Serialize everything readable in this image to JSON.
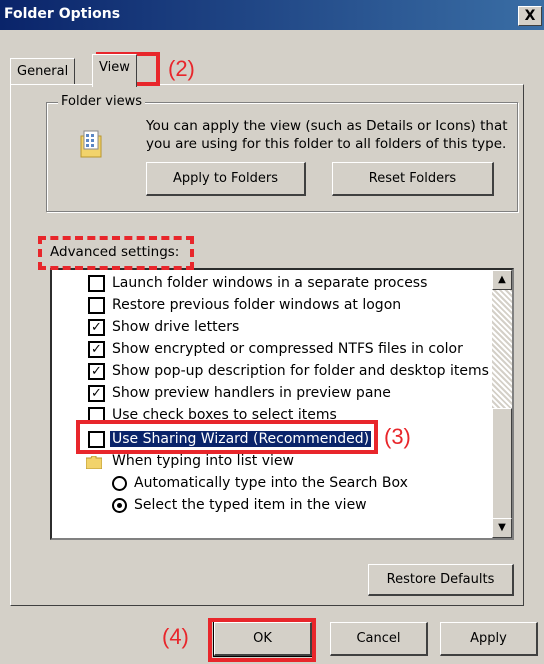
{
  "window": {
    "title": "Folder Options",
    "close_glyph": "X"
  },
  "tabs": [
    {
      "label": "General"
    },
    {
      "label": "View"
    }
  ],
  "folder_views": {
    "legend": "Folder views",
    "description_line1": "You can apply the view (such as Details or Icons) that",
    "description_line2": "you are using for this folder to all folders of this type.",
    "apply_button": "Apply to Folders",
    "reset_button": "Reset Folders",
    "icon": "folder-views-icon"
  },
  "advanced": {
    "label": "Advanced settings:",
    "items": [
      {
        "type": "checkbox",
        "checked": false,
        "label": "Launch folder windows in a separate process"
      },
      {
        "type": "checkbox",
        "checked": false,
        "label": "Restore previous folder windows at logon"
      },
      {
        "type": "checkbox",
        "checked": true,
        "label": "Show drive letters"
      },
      {
        "type": "checkbox",
        "checked": true,
        "label": "Show encrypted or compressed NTFS files in color"
      },
      {
        "type": "checkbox",
        "checked": true,
        "label": "Show pop-up description for folder and desktop items"
      },
      {
        "type": "checkbox",
        "checked": true,
        "label": "Show preview handlers in preview pane"
      },
      {
        "type": "checkbox",
        "checked": false,
        "label": "Use check boxes to select items"
      },
      {
        "type": "checkbox",
        "checked": false,
        "label": "Use Sharing Wizard (Recommended)",
        "selected": true
      },
      {
        "type": "folder",
        "label": "When typing into list view"
      },
      {
        "type": "radio",
        "checked": false,
        "label": "Automatically type into the Search Box"
      },
      {
        "type": "radio",
        "checked": true,
        "label": "Select the typed item in the view"
      }
    ],
    "restore_button": "Restore Defaults"
  },
  "buttons": {
    "ok": "OK",
    "cancel": "Cancel",
    "apply": "Apply"
  },
  "annotations": {
    "step2": "(2)",
    "step3": "(3)",
    "step4": "(4)",
    "color": "#e8262b"
  }
}
